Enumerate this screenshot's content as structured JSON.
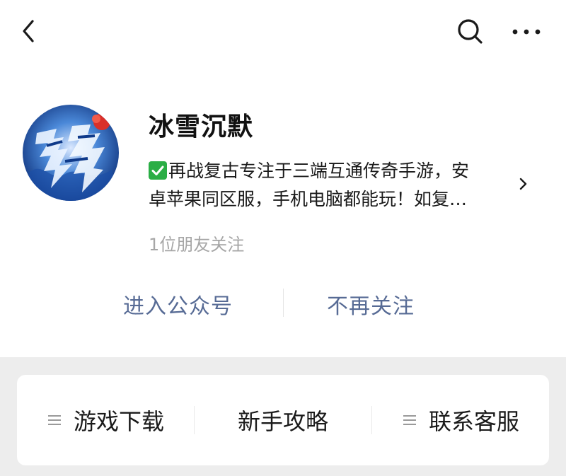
{
  "header": {
    "back_icon": "chevron-left-icon",
    "search_icon": "search-icon",
    "more_icon": "ellipsis-icon"
  },
  "profile": {
    "avatar_icon": "dragon-calligraphy-avatar",
    "name": "冰雪沉默",
    "description_line1": "再战复古专注于三端互通传奇手游，安",
    "description_line2": "卓苹果同区服，手机电脑都能玩！如复…",
    "verified_icon": "check-mark-icon",
    "followers": "1位朋友关注",
    "chevron_icon": "chevron-right-icon"
  },
  "actions": {
    "enter_label": "进入公众号",
    "unfollow_label": "不再关注"
  },
  "menu": {
    "items": [
      {
        "label": "游戏下载",
        "icon": "menu-lines-icon"
      },
      {
        "label": "新手攻略"
      },
      {
        "label": "联系客服",
        "icon": "menu-lines-icon"
      }
    ]
  },
  "colors": {
    "link_blue": "#576b95",
    "verified_green": "#2aae45",
    "page_background": "#ededed"
  }
}
